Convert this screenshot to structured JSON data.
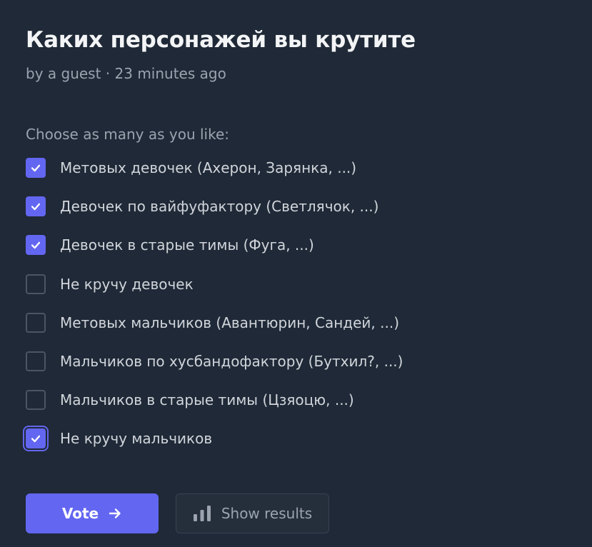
{
  "poll": {
    "title": "Каких персонажей вы крутите",
    "meta": "by a guest · 23 minutes ago",
    "instructions": "Choose as many as you like:"
  },
  "options": [
    {
      "label": "Метовых девочек (Ахерон, Зарянка, ...)",
      "checked": true,
      "focused": false
    },
    {
      "label": "Девочек по вайфуфактору (Светлячок, ...)",
      "checked": true,
      "focused": false
    },
    {
      "label": "Девочек в старые тимы (Фуга, ...)",
      "checked": true,
      "focused": false
    },
    {
      "label": "Не кручу девочек",
      "checked": false,
      "focused": false
    },
    {
      "label": "Метовых мальчиков (Авантюрин, Сандей, ...)",
      "checked": false,
      "focused": false
    },
    {
      "label": "Мальчиков по хусбандофактору (Бутхил?, ...)",
      "checked": false,
      "focused": false
    },
    {
      "label": "Мальчиков в старые тимы (Цзяоцю, ...)",
      "checked": false,
      "focused": false
    },
    {
      "label": "Не кручу мальчиков",
      "checked": true,
      "focused": true
    }
  ],
  "actions": {
    "vote_label": "Vote",
    "vote_icon": "arrow-right-icon",
    "results_label": "Show results",
    "results_icon": "bar-chart-icon"
  },
  "colors": {
    "background": "#1f2937",
    "accent": "#6366f1",
    "text_primary": "#f3f4f6",
    "text_secondary": "#9ca3af"
  }
}
